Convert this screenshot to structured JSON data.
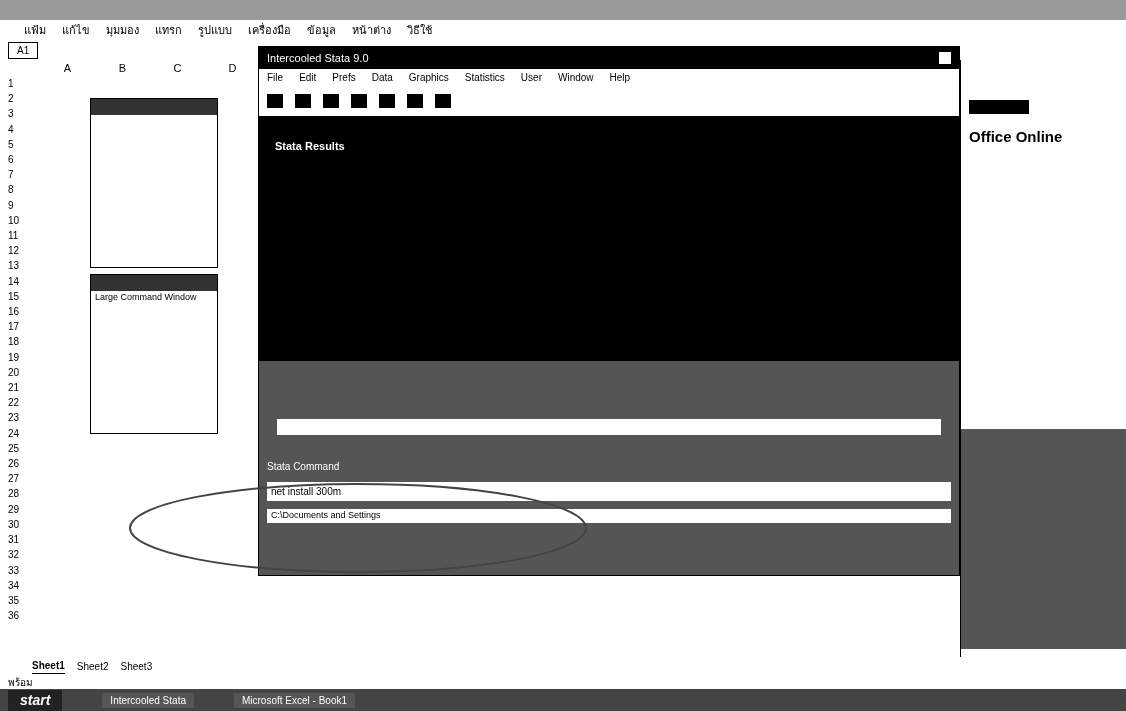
{
  "excel": {
    "menu": [
      "แฟ้ม",
      "แก้ไข",
      "มุมมอง",
      "แทรก",
      "รูปแบบ",
      "เครื่องมือ",
      "ข้อมูล",
      "หน้าต่าง",
      "วิธีใช้"
    ],
    "name_box": "A1",
    "columns": [
      "A",
      "B",
      "C",
      "D"
    ],
    "rows": [
      "1",
      "2",
      "3",
      "4",
      "5",
      "6",
      "7",
      "8",
      "9",
      "10",
      "11",
      "12",
      "13",
      "14",
      "15",
      "16",
      "17",
      "18",
      "19",
      "20",
      "21",
      "22",
      "23",
      "24",
      "25",
      "26",
      "27",
      "28",
      "29",
      "30",
      "31",
      "32",
      "33",
      "34",
      "35",
      "36"
    ],
    "sheet_tabs": [
      {
        "label": "Sheet1",
        "selected": true
      },
      {
        "label": "Sheet2",
        "selected": false
      },
      {
        "label": "Sheet3",
        "selected": false
      }
    ],
    "status": "พร้อม"
  },
  "side_window": {
    "body": "Large Command Window"
  },
  "task_pane": {
    "title": "Office Online"
  },
  "stata": {
    "title": "Intercooled Stata 9.0",
    "menu": [
      "File",
      "Edit",
      "Prefs",
      "Data",
      "Graphics",
      "Statistics",
      "User",
      "Window",
      "Help"
    ],
    "results_title": "Stata Results",
    "command_title": "Stata Command",
    "command": "net install 300m",
    "path": "C:\\Documents and Settings"
  },
  "taskbar": {
    "start": "start",
    "tasks": [
      "Intercooled Stata",
      "Microsoft Excel - Book1"
    ]
  }
}
